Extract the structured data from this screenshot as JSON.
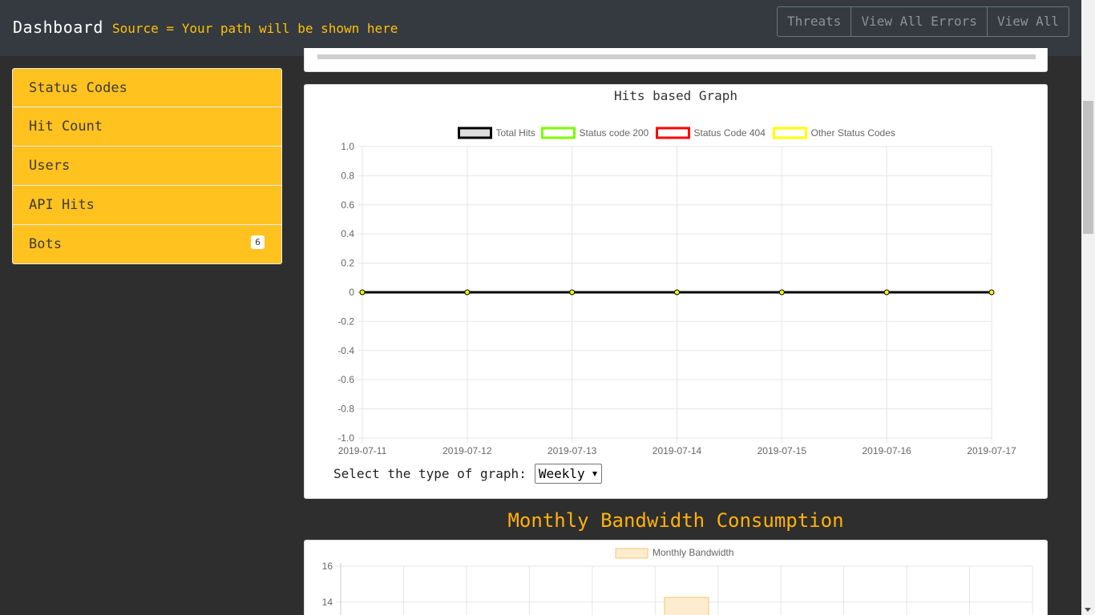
{
  "nav": {
    "brand": "Dashboard",
    "source": "Source = Your path will be shown here",
    "buttons": [
      "Threats",
      "View All Errors",
      "View All"
    ]
  },
  "sidebar": {
    "items": [
      {
        "label": "Status Codes"
      },
      {
        "label": "Hit Count"
      },
      {
        "label": "Users"
      },
      {
        "label": "API Hits"
      },
      {
        "label": "Bots",
        "badge": "6"
      }
    ]
  },
  "hits_graph": {
    "title": "Hits based Graph",
    "select_label": "Select the type of graph:",
    "select_value": "Weekly"
  },
  "bandwidth": {
    "section_title": "Monthly Bandwidth Consumption"
  },
  "colors": {
    "accent": "#ffc21f",
    "navbar": "#343a40",
    "section_title": "#ffb20a"
  },
  "chart_data": [
    {
      "type": "line",
      "title": "Hits based Graph",
      "x": [
        "2019-07-11",
        "2019-07-12",
        "2019-07-13",
        "2019-07-14",
        "2019-07-15",
        "2019-07-16",
        "2019-07-17"
      ],
      "ylim": [
        -1.0,
        1.0
      ],
      "yticks": [
        "1.0",
        "0.8",
        "0.6",
        "0.4",
        "0.2",
        "0",
        "-0.2",
        "-0.4",
        "-0.6",
        "-0.8",
        "-1.0"
      ],
      "grid": true,
      "legend_position": "top",
      "series": [
        {
          "name": "Total Hits",
          "color": "#000000",
          "fill": "#dddddd",
          "values": [
            0,
            0,
            0,
            0,
            0,
            0,
            0
          ]
        },
        {
          "name": "Status code 200",
          "color": "#7cfc00",
          "fill": "#ffffff",
          "values": [
            0,
            0,
            0,
            0,
            0,
            0,
            0
          ]
        },
        {
          "name": "Status Code 404",
          "color": "#ff0000",
          "fill": "#ffffff",
          "values": [
            0,
            0,
            0,
            0,
            0,
            0,
            0
          ]
        },
        {
          "name": "Other Status Codes",
          "color": "#ffff00",
          "fill": "#ffffff",
          "values": [
            0,
            0,
            0,
            0,
            0,
            0,
            0
          ]
        }
      ]
    },
    {
      "type": "bar",
      "yticks": [
        "16",
        "14"
      ],
      "grid": true,
      "legend_position": "top",
      "series": [
        {
          "name": "Monthly Bandwidth",
          "color": "#f5c46a",
          "fill": "#fdecd0"
        }
      ]
    }
  ]
}
